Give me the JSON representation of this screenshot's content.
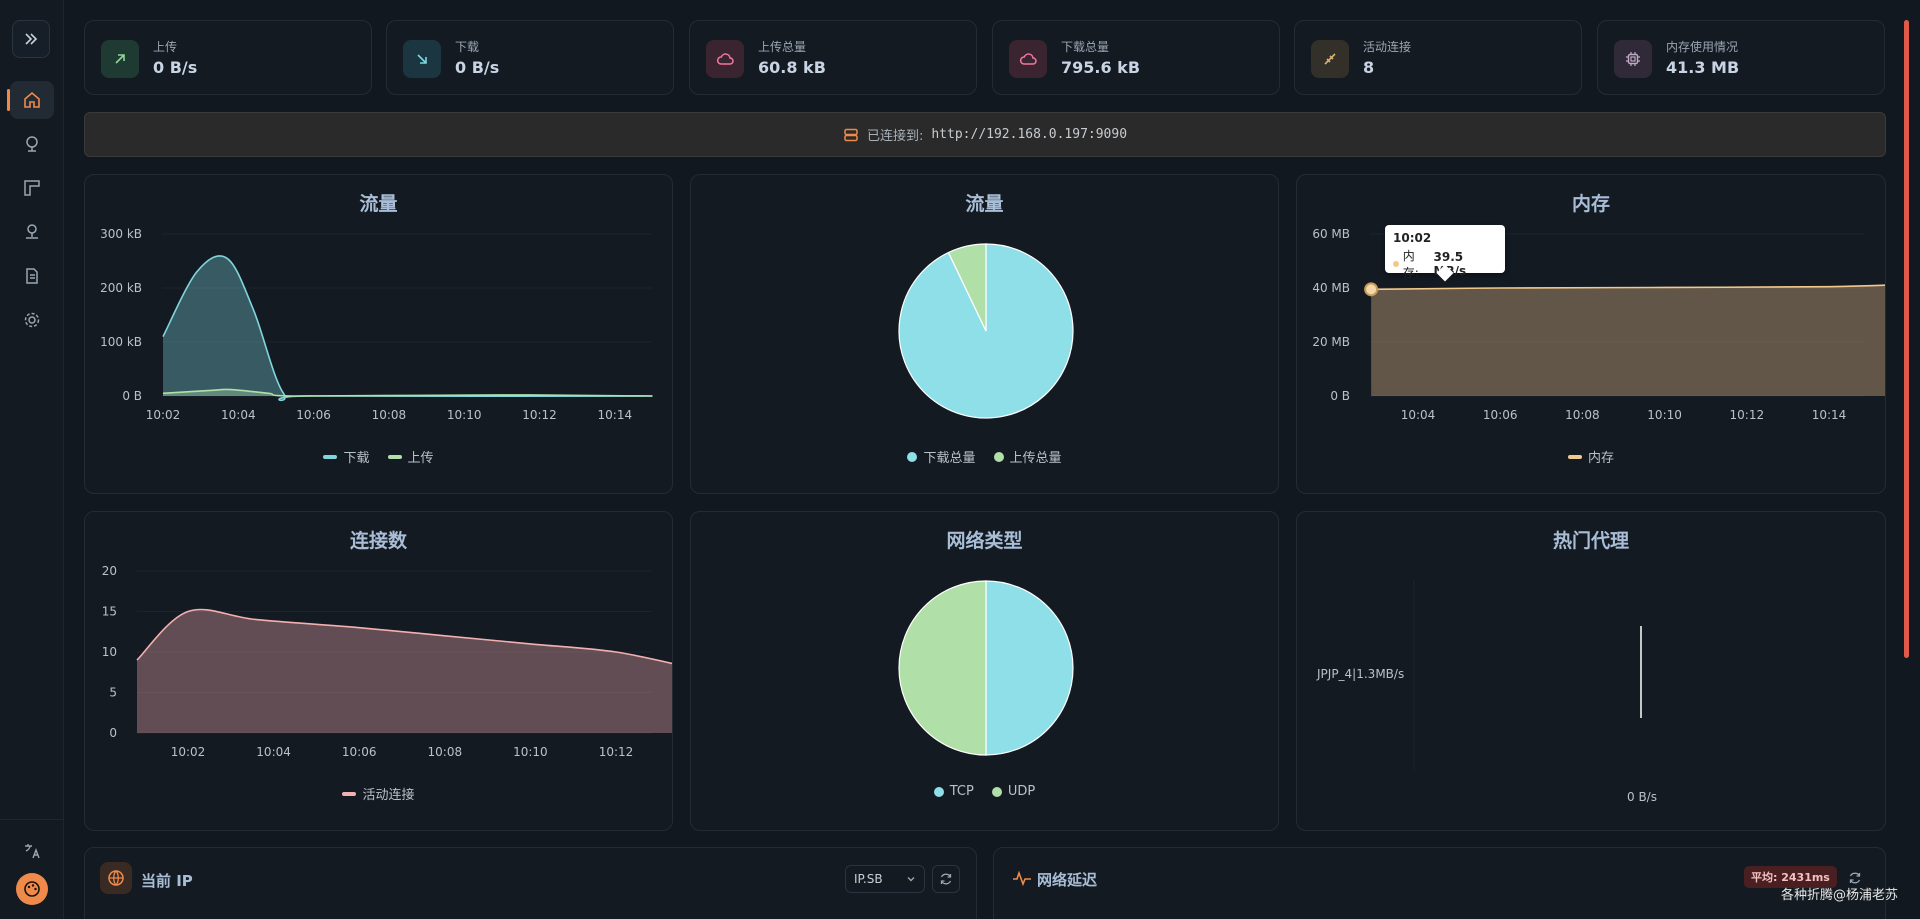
{
  "stats": [
    {
      "label": "上传",
      "value": "0 B/s",
      "icon": "arrow-up-right-icon",
      "color": "#8fd694",
      "bg": "#1f3a33"
    },
    {
      "label": "下载",
      "value": "0 B/s",
      "icon": "arrow-down-right-icon",
      "color": "#7fd6de",
      "bg": "#1b3640"
    },
    {
      "label": "上传总量",
      "value": "60.8 kB",
      "icon": "cloud-icon",
      "color": "#f07a9a",
      "bg": "#3a2430"
    },
    {
      "label": "下载总量",
      "value": "795.6 kB",
      "icon": "cloud-icon",
      "color": "#f07a9a",
      "bg": "#3a2430"
    },
    {
      "label": "活动连接",
      "value": "8",
      "icon": "plug-icon",
      "color": "#d8b070",
      "bg": "#33302a"
    },
    {
      "label": "内存使用情况",
      "value": "41.3 MB",
      "icon": "chip-icon",
      "color": "#c0aac8",
      "bg": "#302a38"
    }
  ],
  "banner": {
    "label": "已连接到:",
    "url": "http://192.168.0.197:9090"
  },
  "colors": {
    "download": "#7fd6de",
    "upload": "#b0e0a8",
    "memory": "#f3c98b",
    "connections": "#f4b0b0",
    "accent": "#f08a4b"
  },
  "traffic_chart": {
    "title": "流量",
    "legend": [
      "下载",
      "上传"
    ]
  },
  "traffic_pie": {
    "title": "流量",
    "legend": [
      "下载总量",
      "上传总量"
    ]
  },
  "memory_chart": {
    "title": "内存",
    "legend": [
      "内存"
    ],
    "tooltip": {
      "time": "10:02",
      "label": "内存:",
      "value": "39.5 MB/s"
    }
  },
  "conn_chart": {
    "title": "连接数",
    "legend": [
      "活动连接"
    ]
  },
  "net_pie": {
    "title": "网络类型",
    "legend": [
      "TCP",
      "UDP"
    ]
  },
  "hot_proxy": {
    "title": "热门代理",
    "label": "JPJP_4|1.3MB/s",
    "axis": "0 B/s"
  },
  "current_ip": {
    "title": "当前 IP",
    "provider": "IP.SB"
  },
  "latency": {
    "title": "网络延迟",
    "badge": "平均: 2431ms"
  },
  "watermark": "各种折腾@杨浦老苏",
  "chart_data": [
    {
      "type": "area",
      "title": "流量",
      "x": [
        "10:02",
        "10:04",
        "10:06",
        "10:08",
        "10:10",
        "10:12",
        "10:14"
      ],
      "ylim": [
        0,
        300
      ],
      "yticks": [
        "0 B",
        "100 kB",
        "200 kB",
        "300 kB"
      ],
      "series": [
        {
          "name": "下载",
          "points": [
            [
              0.0,
              110
            ],
            [
              0.45,
              230
            ],
            [
              0.85,
              255
            ],
            [
              1.2,
              160
            ],
            [
              1.6,
              5
            ],
            [
              2.0,
              0
            ],
            [
              6.5,
              0
            ]
          ]
        },
        {
          "name": "上传",
          "points": [
            [
              0.0,
              5
            ],
            [
              0.6,
              10
            ],
            [
              0.9,
              12
            ],
            [
              1.4,
              5
            ],
            [
              1.8,
              0
            ],
            [
              4.5,
              2
            ],
            [
              6.5,
              0
            ]
          ]
        }
      ]
    },
    {
      "type": "pie",
      "title": "流量",
      "labels": [
        "下载总量",
        "上传总量"
      ],
      "values": [
        795.6,
        60.8
      ]
    },
    {
      "type": "area",
      "title": "内存",
      "x": [
        "10:04",
        "10:06",
        "10:08",
        "10:10",
        "10:12",
        "10:14"
      ],
      "ylim": [
        0,
        60
      ],
      "yticks": [
        "0 B",
        "20 MB",
        "40 MB",
        "60 MB"
      ],
      "series": [
        {
          "name": "内存",
          "points": [
            [
              -0.57,
              39.5
            ],
            [
              1,
              40
            ],
            [
              3,
              40.2
            ],
            [
              5,
              40.5
            ],
            [
              5.9,
              41.3
            ]
          ]
        }
      ]
    },
    {
      "type": "area",
      "title": "连接数",
      "x": [
        "10:02",
        "10:04",
        "10:06",
        "10:08",
        "10:10",
        "10:12"
      ],
      "ylim": [
        0,
        20
      ],
      "yticks": [
        "0",
        "5",
        "10",
        "15",
        "20"
      ],
      "series": [
        {
          "name": "活动连接",
          "points": [
            [
              -0.6,
              9
            ],
            [
              0,
              15
            ],
            [
              0.8,
              14
            ],
            [
              2,
              13
            ],
            [
              3,
              12
            ],
            [
              4,
              11
            ],
            [
              5,
              10
            ],
            [
              5.9,
              8
            ]
          ]
        }
      ]
    },
    {
      "type": "pie",
      "title": "网络类型",
      "labels": [
        "TCP",
        "UDP"
      ],
      "values": [
        50,
        50
      ]
    }
  ]
}
